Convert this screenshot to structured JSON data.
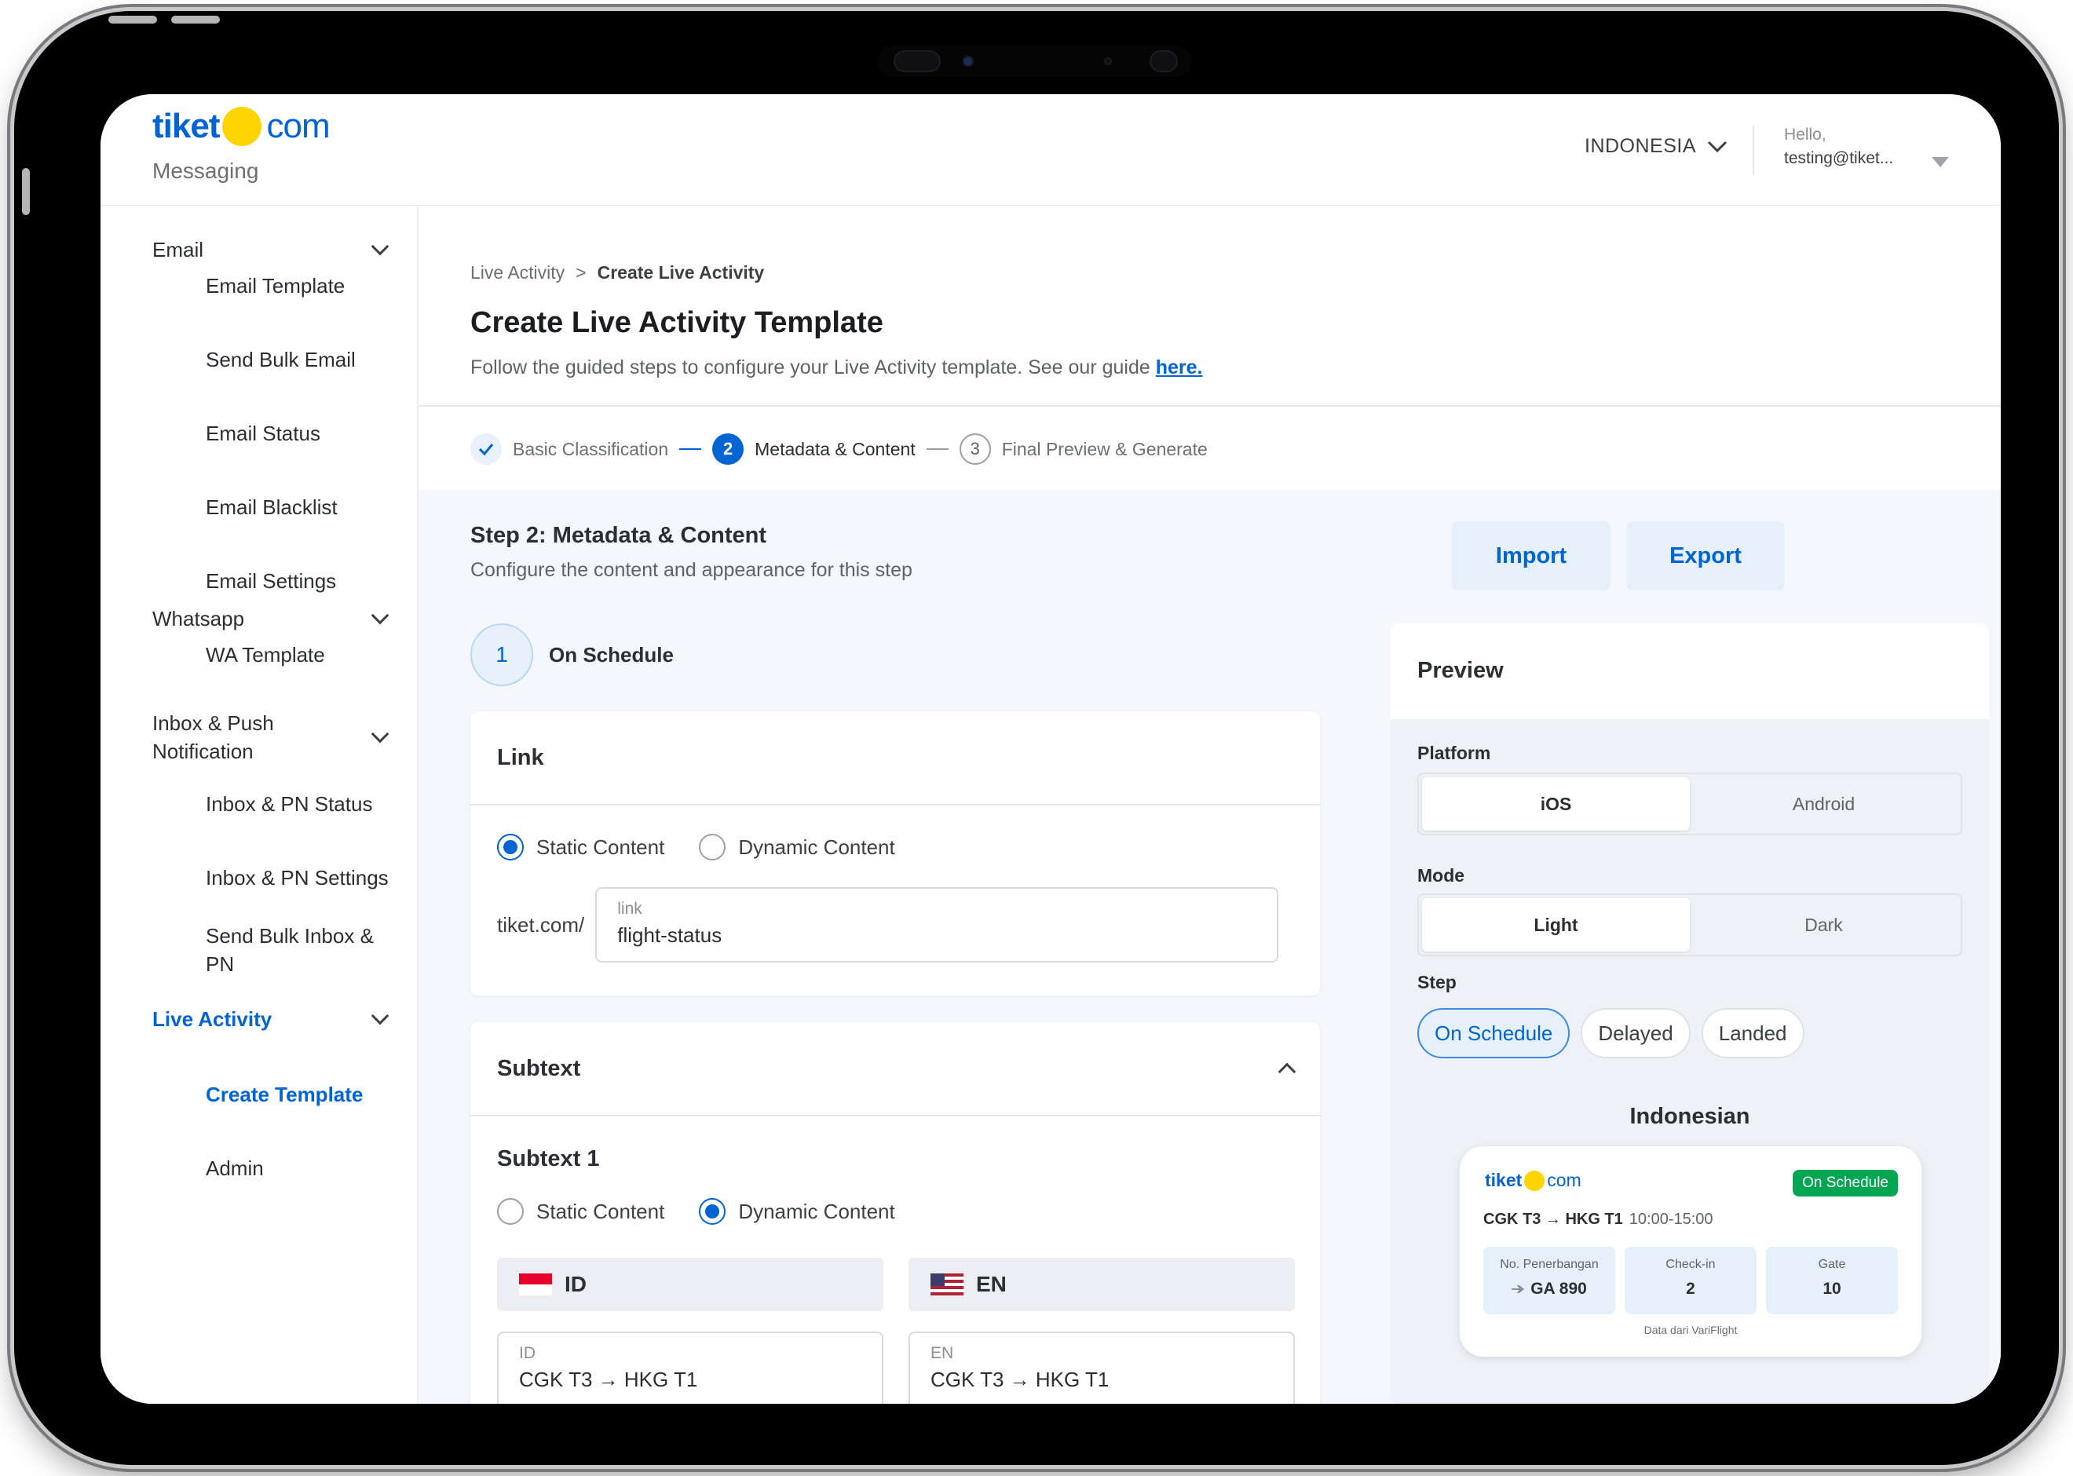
{
  "brand": {
    "name": "tiket",
    "suffix": "com",
    "product": "Messaging",
    "primary_color": "#0064d2",
    "dot_color": "#ffd500"
  },
  "header": {
    "country": "INDONESIA",
    "greeting": "Hello,",
    "user_email": "testing@tiket..."
  },
  "sidebar": {
    "email": "Email",
    "email_items": [
      "Email Template",
      "Send Bulk Email",
      "Email Status",
      "Email Blacklist",
      "Email Settings"
    ],
    "whatsapp": "Whatsapp",
    "whatsapp_items": [
      "WA Template"
    ],
    "inbox": "Inbox & Push Notification",
    "inbox_items": [
      "Inbox & PN Status",
      "Inbox & PN Settings",
      "Send Bulk Inbox & PN"
    ],
    "live_activity": "Live Activity",
    "live_items": [
      "Create Template",
      "Admin"
    ]
  },
  "page": {
    "breadcrumb_parent": "Live Activity",
    "breadcrumb_sep": ">",
    "breadcrumb_current": "Create Live Activity",
    "title": "Create Live Activity Template",
    "description": "Follow the guided steps to configure your Live Activity template. See our guide ",
    "guide_link": "here."
  },
  "stepper": [
    {
      "label": "Basic Classification",
      "state": "done"
    },
    {
      "num": "2",
      "label": "Metadata & Content",
      "state": "active"
    },
    {
      "num": "3",
      "label": "Final Preview & Generate",
      "state": "next"
    }
  ],
  "step_section": {
    "title": "Step 2: Metadata & Content",
    "subtitle": "Configure the content and appearance for this step",
    "import_label": "Import",
    "export_label": "Export",
    "step_num": "1",
    "step_name": "On Schedule"
  },
  "link_card": {
    "title": "Link",
    "static_label": "Static Content",
    "dynamic_label": "Dynamic Content",
    "selected": "static",
    "prefix": "tiket.com/",
    "field_label": "link",
    "field_value": "flight-status"
  },
  "subtext_card": {
    "title": "Subtext",
    "sub_title": "Subtext 1",
    "static_label": "Static Content",
    "dynamic_label": "Dynamic Content",
    "selected": "dynamic",
    "tab_id": "ID",
    "tab_en": "EN",
    "field_id_label": "ID",
    "field_id_value": "CGK T3 → HKG T1",
    "field_en_label": "EN",
    "field_en_value": "CGK T3 → HKG T1"
  },
  "preview": {
    "title": "Preview",
    "platform_label": "Platform",
    "platform_options": [
      "iOS",
      "Android"
    ],
    "platform_selected": "iOS",
    "mode_label": "Mode",
    "mode_options": [
      "Light",
      "Dark"
    ],
    "mode_selected": "Light",
    "step_label": "Step",
    "step_options": [
      "On Schedule",
      "Delayed",
      "Landed"
    ],
    "step_selected": "On Schedule",
    "language": "Indonesian",
    "card": {
      "status": "On Schedule",
      "status_color": "#00a651",
      "route": "CGK T3 → HKG T1",
      "time": "10:00-15:00",
      "boxes": [
        {
          "label": "No. Penerbangan",
          "value": "GA 890"
        },
        {
          "label": "Check-in",
          "value": "2"
        },
        {
          "label": "Gate",
          "value": "10"
        }
      ],
      "footer": "Data dari VariFlight"
    }
  }
}
